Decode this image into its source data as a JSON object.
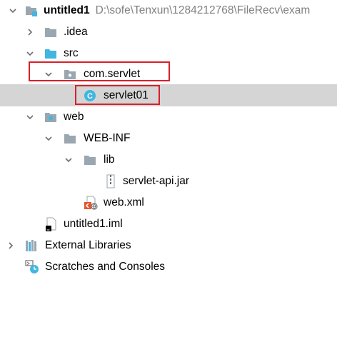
{
  "tree": {
    "project": {
      "name": "untitled1",
      "path": "D:\\sofe\\Tenxun\\1284212768\\FileRecv\\exam"
    },
    "idea": ".idea",
    "src": "src",
    "package": "com.servlet",
    "servlet_class": "servlet01",
    "web": "web",
    "web_inf": "WEB-INF",
    "lib": "lib",
    "jar": "servlet-api.jar",
    "web_xml": "web.xml",
    "iml": "untitled1.iml",
    "external_libraries": "External Libraries",
    "scratches": "Scratches and Consoles"
  },
  "colors": {
    "selection": "#d5d5d5",
    "highlight": "#d9202a",
    "folder": "#9aa7b0",
    "source_folder": "#40b6e0"
  }
}
